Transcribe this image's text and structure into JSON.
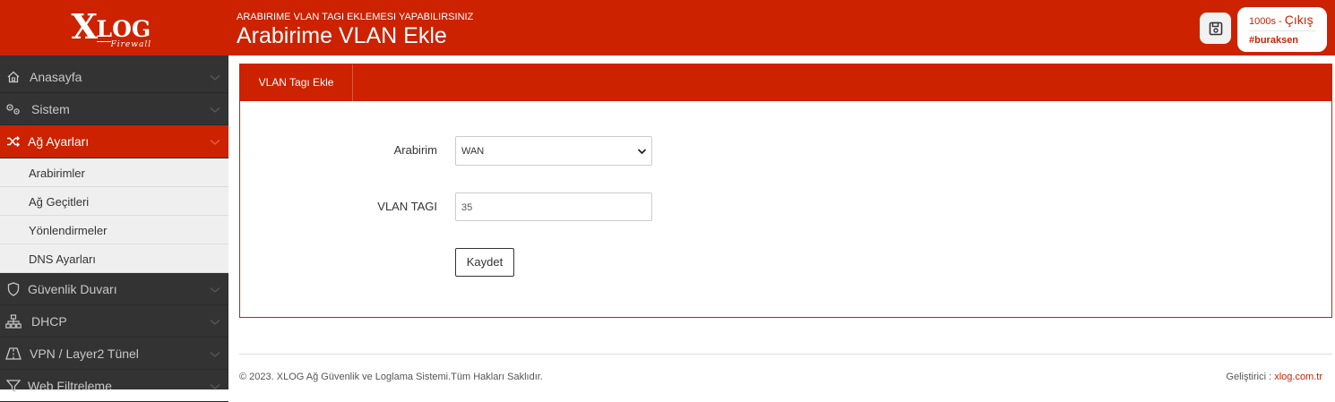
{
  "brand": {
    "logo_x": "X",
    "logo_log": "LOG",
    "logo_sub": "Firewall"
  },
  "header": {
    "subtitle": "ARABIRIME VLAN TAGI EKLEMESI YAPABILIRSINIZ",
    "title": "Arabirime VLAN Ekle",
    "save_icon": "floppy-disk-icon"
  },
  "user": {
    "timer": "1000s",
    "sep": " - ",
    "logout": "Çıkış",
    "name": "#buraksen"
  },
  "sidebar": {
    "items": [
      {
        "label": "Anasayfa",
        "icon": "home-icon"
      },
      {
        "label": "Sistem",
        "icon": "gears-icon"
      },
      {
        "label": "Ağ Ayarları",
        "icon": "shuffle-icon",
        "active": true,
        "children": [
          "Arabirimler",
          "Ağ Geçitleri",
          "Yönlendirmeler",
          "DNS Ayarları"
        ]
      },
      {
        "label": "Güvenlik Duvarı",
        "icon": "shield-icon"
      },
      {
        "label": "DHCP",
        "icon": "network-icon"
      },
      {
        "label": "VPN / Layer2 Tünel",
        "icon": "road-icon"
      },
      {
        "label": "Web Filtreleme",
        "icon": "filter-icon"
      }
    ]
  },
  "panel": {
    "tab": "VLAN Tagı Ekle",
    "fields": {
      "interface_label": "Arabirim",
      "interface_value": "WAN",
      "vlan_label": "VLAN TAGI",
      "vlan_value": "35"
    },
    "submit": "Kaydet"
  },
  "footer": {
    "copyright": "© 2023. XLOG Ağ Güvenlik ve Loglama Sistemi.Tüm Hakları Saklıdır.",
    "dev_label": "Geliştirici : ",
    "dev_link": "xlog.com.tr"
  },
  "colors": {
    "accent": "#cc2200",
    "sidebar": "#333333",
    "submenu": "#efefef"
  }
}
